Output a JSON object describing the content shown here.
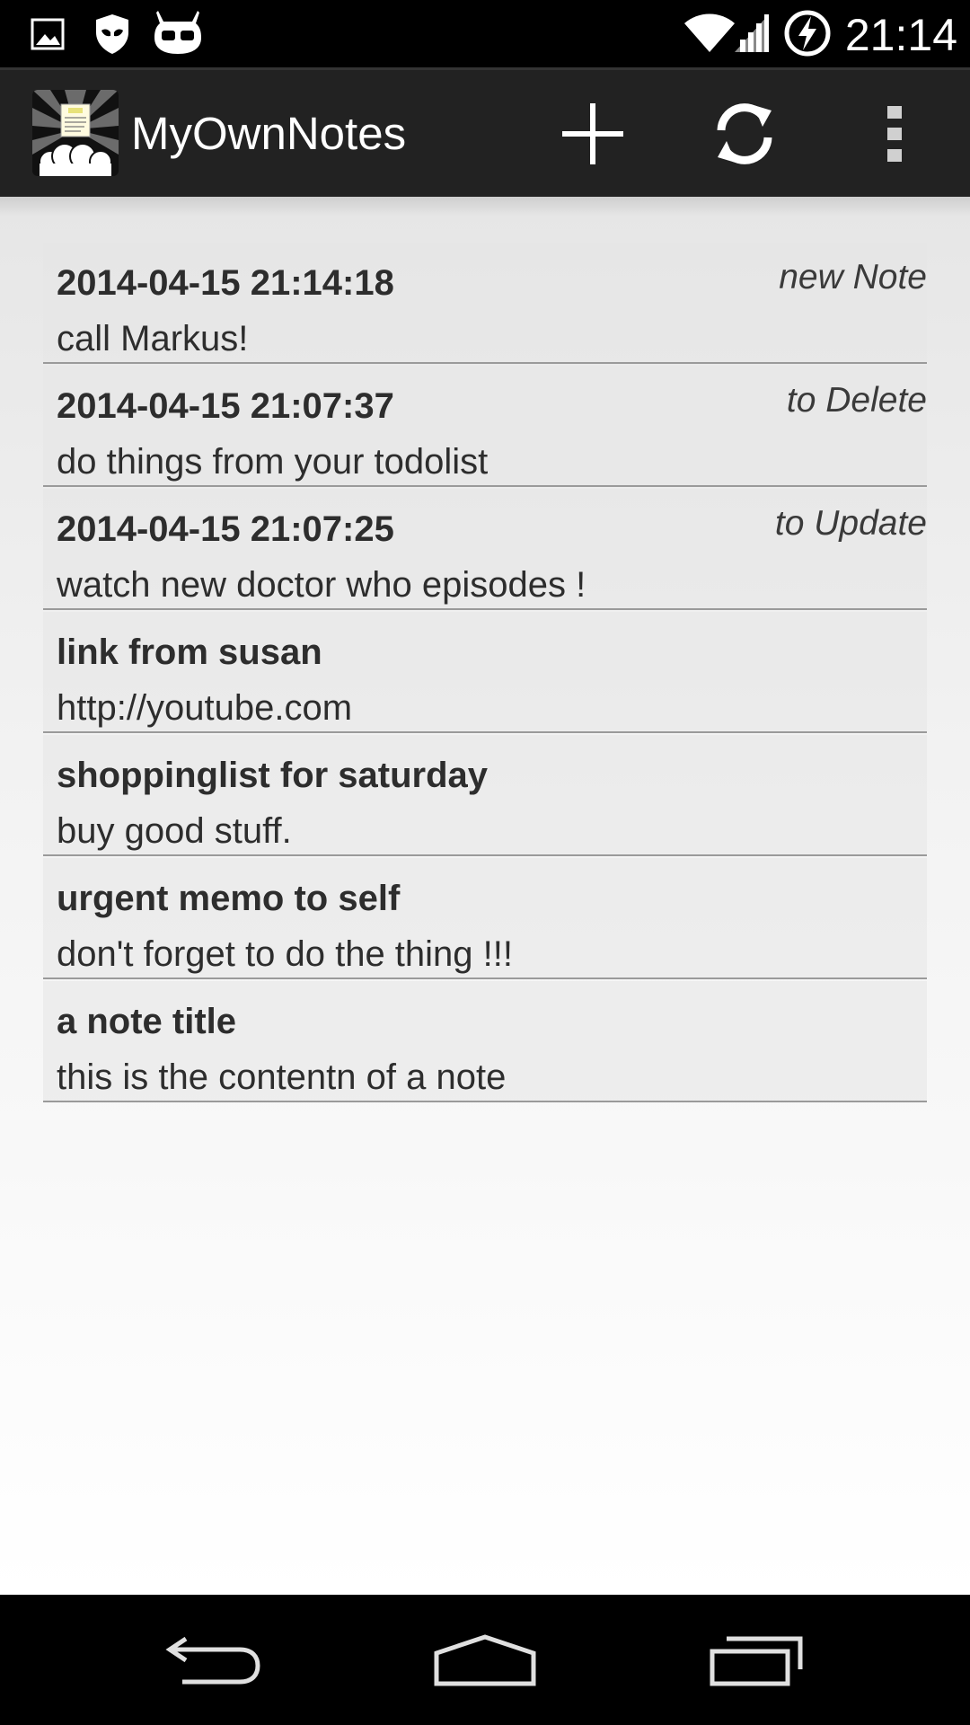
{
  "status_bar": {
    "time": "21:14",
    "left_icons": [
      "image-icon",
      "shield-icon",
      "cyanogen-mascot-icon"
    ],
    "right_icons": [
      "wifi-icon",
      "signal-icon",
      "battery-charging-icon"
    ]
  },
  "action_bar": {
    "title": "MyOwnNotes",
    "actions": [
      "add-icon",
      "sync-icon",
      "overflow-menu-icon"
    ]
  },
  "notes": [
    {
      "title": "2014-04-15 21:14:18",
      "content": "call Markus!",
      "status": "new Note"
    },
    {
      "title": "2014-04-15 21:07:37",
      "content": "do things from your todolist",
      "status": "to Delete"
    },
    {
      "title": "2014-04-15 21:07:25",
      "content": "watch new doctor who episodes !",
      "status": "to Update"
    },
    {
      "title": "link from susan",
      "content": "http://youtube.com",
      "status": ""
    },
    {
      "title": "shoppinglist for saturday",
      "content": "buy good stuff.",
      "status": ""
    },
    {
      "title": "urgent memo to self",
      "content": "don't forget to do the thing !!!",
      "status": ""
    },
    {
      "title": "a note title",
      "content": "this is the contentn of a note",
      "status": ""
    }
  ],
  "nav_bar": {
    "buttons": [
      "back-icon",
      "home-icon",
      "recents-icon"
    ]
  },
  "colors": {
    "action_bar": "#222222",
    "status_bar": "#000000",
    "text": "#2d2d2d",
    "divider": "#9a9a9a"
  }
}
